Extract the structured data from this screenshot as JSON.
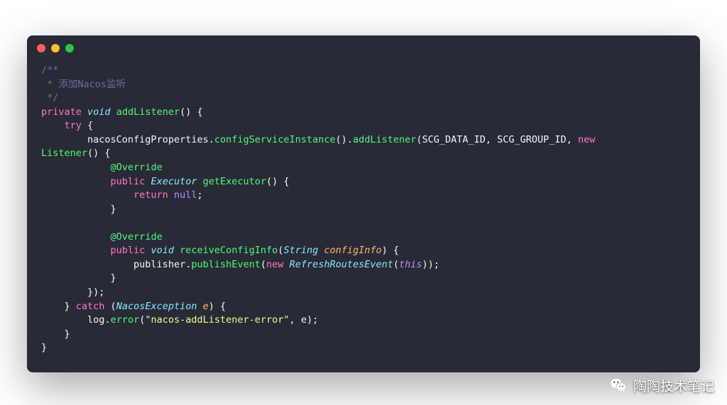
{
  "watermark": {
    "text": "陶陶技术笔记"
  },
  "code": {
    "comment_open": "/**",
    "comment_text": " * 添加Nacos监听",
    "comment_close": " */",
    "kw_private": "private",
    "kw_void": "void",
    "kw_try": "try",
    "kw_catch": "catch",
    "kw_new": "new",
    "kw_return": "return",
    "kw_public": "public",
    "kw_null": "null",
    "kw_this": "this",
    "fn_addListener": "addListener",
    "fn_configServiceInstance": "configServiceInstance",
    "fn_getExecutor": "getExecutor",
    "fn_receiveConfigInfo": "receiveConfigInfo",
    "fn_publishEvent": "publishEvent",
    "fn_error": "error",
    "id_nacosConfigProperties": "nacosConfigProperties",
    "id_SCG_DATA_ID": "SCG_DATA_ID",
    "id_SCG_GROUP_ID": "SCG_GROUP_ID",
    "id_Listener": "Listener",
    "id_publisher": "publisher",
    "id_log": "log",
    "id_e": "e",
    "id_configInfo": "configInfo",
    "type_Executor": "Executor",
    "type_String": "String",
    "type_NacosException": "NacosException",
    "type_RefreshRoutesEvent": "RefreshRoutesEvent",
    "annot_Override": "@Override",
    "str_error": "\"nacos-addListener-error\""
  }
}
